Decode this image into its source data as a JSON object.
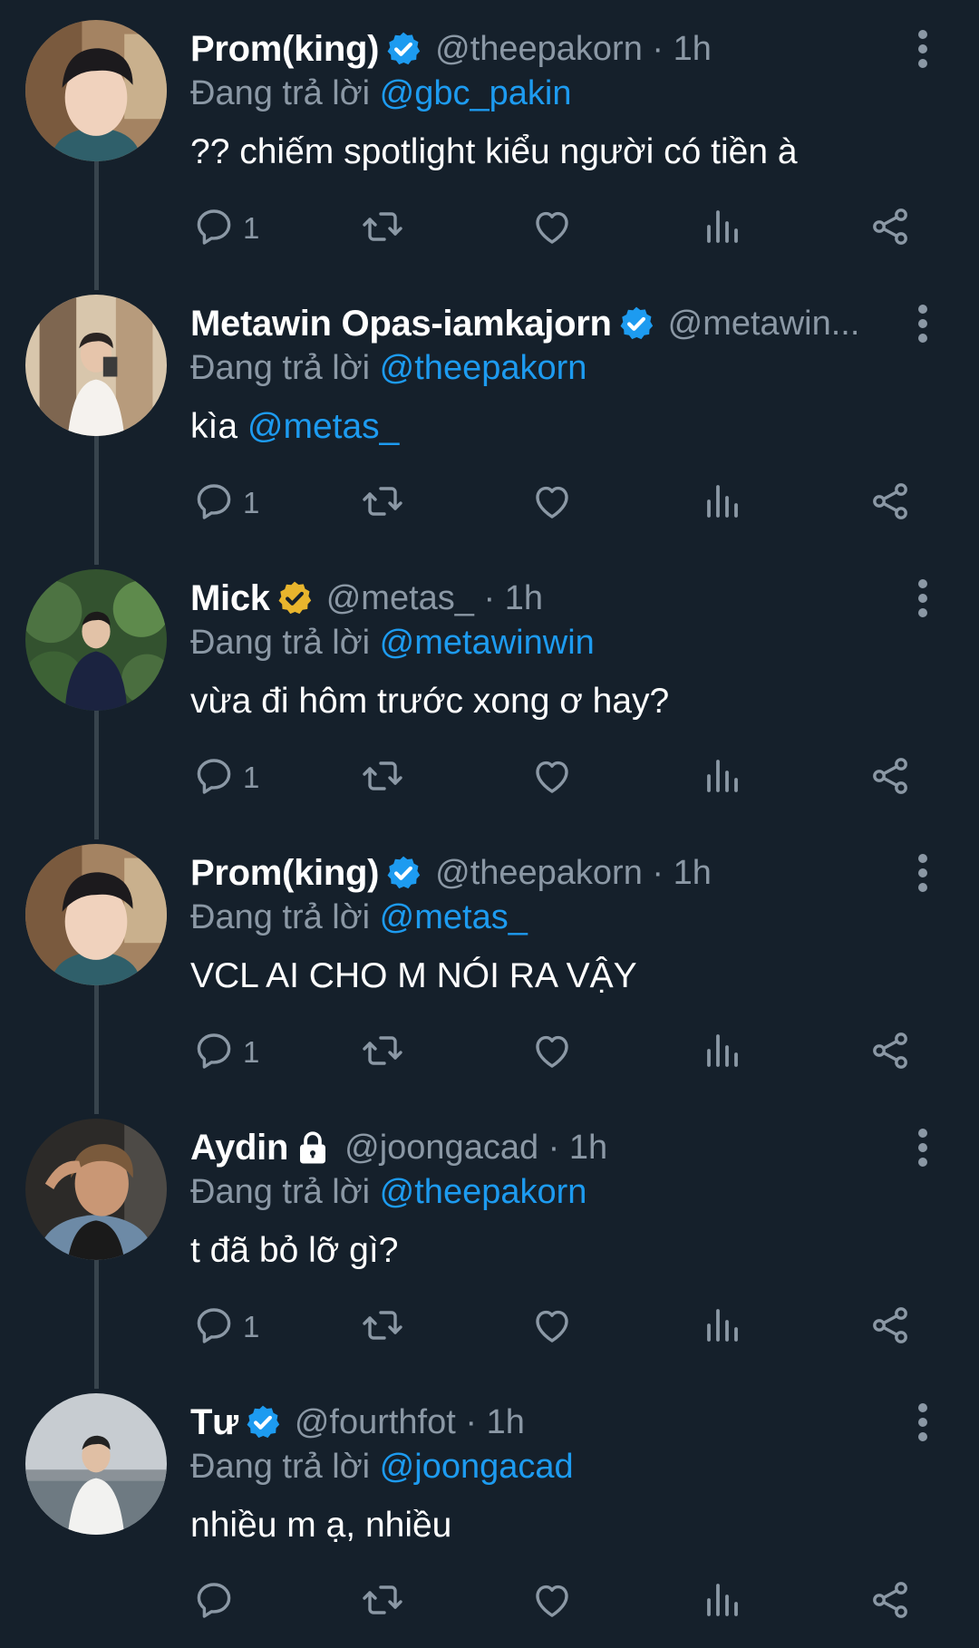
{
  "reply_prefix": "Đang trả lời",
  "colors": {
    "background": "#15202b",
    "accent": "#1d9bf0",
    "muted": "#8b98a5",
    "verified": "#1d9bf0",
    "gold": "#e8b52d"
  },
  "tweets": [
    {
      "name": "Prom(king)",
      "badge": "verified-blue",
      "handle": "@theepakorn · 1h",
      "replying_to": "@gbc_pakin",
      "text": "?? chiếm spotlight kiểu người có tiền à",
      "mention": "",
      "reply_count": "1",
      "avatar": "avatar-prom",
      "thread": true
    },
    {
      "name": "Metawin Opas-iamkajorn",
      "badge": "verified-blue",
      "handle": "@metawin...",
      "replying_to": "@theepakorn",
      "text": "kìa ",
      "mention": "@metas_",
      "reply_count": "1",
      "avatar": "avatar-metawin",
      "thread": true
    },
    {
      "name": "Mick",
      "badge": "verified-gold",
      "handle": "@metas_ · 1h",
      "replying_to": "@metawinwin",
      "text": "vừa đi hôm trước xong ơ hay?",
      "mention": "",
      "reply_count": "1",
      "avatar": "avatar-mick",
      "thread": true
    },
    {
      "name": "Prom(king)",
      "badge": "verified-blue",
      "handle": "@theepakorn · 1h",
      "replying_to": "@metas_",
      "text": "VCL AI CHO M NÓI RA VẬY",
      "mention": "",
      "reply_count": "1",
      "avatar": "avatar-prom",
      "thread": true
    },
    {
      "name": "Aydin",
      "badge": "lock",
      "handle": "@joongacad · 1h",
      "replying_to": "@theepakorn",
      "text": "t đã bỏ lỡ gì?",
      "mention": "",
      "reply_count": "1",
      "avatar": "avatar-aydin",
      "thread": true
    },
    {
      "name": "Tư",
      "badge": "verified-blue",
      "handle": "@fourthfot · 1h",
      "replying_to": "@joongacad",
      "text": "nhiều m ạ, nhiều",
      "mention": "",
      "reply_count": "",
      "avatar": "avatar-tu",
      "thread": false
    }
  ]
}
